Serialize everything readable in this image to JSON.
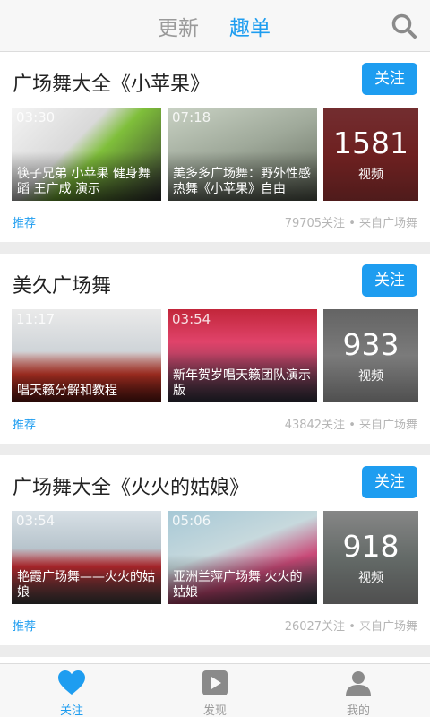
{
  "header": {
    "tabs": [
      {
        "label": "更新"
      },
      {
        "label": "趣单"
      }
    ]
  },
  "cards": [
    {
      "title": "广场舞大全《小苹果》",
      "follow_label": "关注",
      "videos": [
        {
          "duration": "03:30",
          "title": "筷子兄弟 小苹果 健身舞蹈 王广成 演示"
        },
        {
          "duration": "07:18",
          "title": "美多多广场舞：野外性感热舞《小苹果》自由"
        }
      ],
      "video_count": "1581",
      "video_count_label": "视频",
      "tag": "推荐",
      "meta": "79705关注 • 来自广场舞"
    },
    {
      "title": "美久广场舞",
      "follow_label": "关注",
      "videos": [
        {
          "duration": "11:17",
          "title": "唱天籁分解和教程"
        },
        {
          "duration": "03:54",
          "title": "新年贺岁唱天籁团队演示版"
        }
      ],
      "video_count": "933",
      "video_count_label": "视频",
      "tag": "推荐",
      "meta": "43842关注 • 来自广场舞"
    },
    {
      "title": "广场舞大全《火火的姑娘》",
      "follow_label": "关注",
      "videos": [
        {
          "duration": "03:54",
          "title": "艳霞广场舞——火火的姑娘"
        },
        {
          "duration": "05:06",
          "title": "亚洲兰萍广场舞 火火的姑娘"
        }
      ],
      "video_count": "918",
      "video_count_label": "视频",
      "tag": "推荐",
      "meta": "26027关注 • 来自广场舞"
    }
  ],
  "bottom_nav": [
    {
      "label": "关注",
      "icon": "heart-icon"
    },
    {
      "label": "发现",
      "icon": "play-icon"
    },
    {
      "label": "我的",
      "icon": "person-icon"
    }
  ],
  "colors": {
    "accent": "#1e9df0",
    "inactive": "#9a9a9a"
  }
}
